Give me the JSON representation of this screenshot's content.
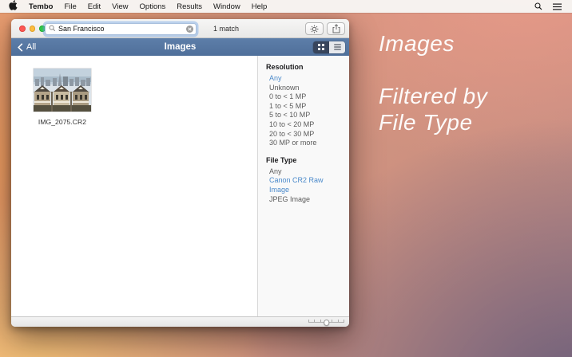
{
  "menu_bar": {
    "app_name": "Tembo",
    "menus": [
      "File",
      "Edit",
      "View",
      "Options",
      "Results",
      "Window",
      "Help"
    ]
  },
  "toolbar": {
    "search": {
      "value": "San Francisco"
    },
    "match_count": "1 match"
  },
  "header": {
    "back_label": "All",
    "title": "Images"
  },
  "results": {
    "items": [
      {
        "filename": "IMG_2075.CR2"
      }
    ]
  },
  "filters": {
    "resolution": {
      "title": "Resolution",
      "selected": "Any",
      "options": [
        "Any",
        "Unknown",
        "0 to < 1 MP",
        "1 to < 5 MP",
        "5 to < 10 MP",
        "10 to < 20 MP",
        "20 to < 30 MP",
        "30 MP or more"
      ]
    },
    "file_type": {
      "title": "File Type",
      "selected": "Canon CR2 Raw Image",
      "options": [
        "Any",
        "Canon CR2 Raw Image",
        "JPEG Image"
      ]
    }
  },
  "desktop_caption": {
    "line1": "Images",
    "line2": "Filtered by",
    "line3": "File Type"
  },
  "colors": {
    "header_blue": "#54749f",
    "accent_blue": "#4a89ca",
    "selected_segment": "#38455c",
    "traffic_red": "#fc5753",
    "traffic_yellow": "#fdbc40",
    "traffic_green": "#33c748"
  }
}
